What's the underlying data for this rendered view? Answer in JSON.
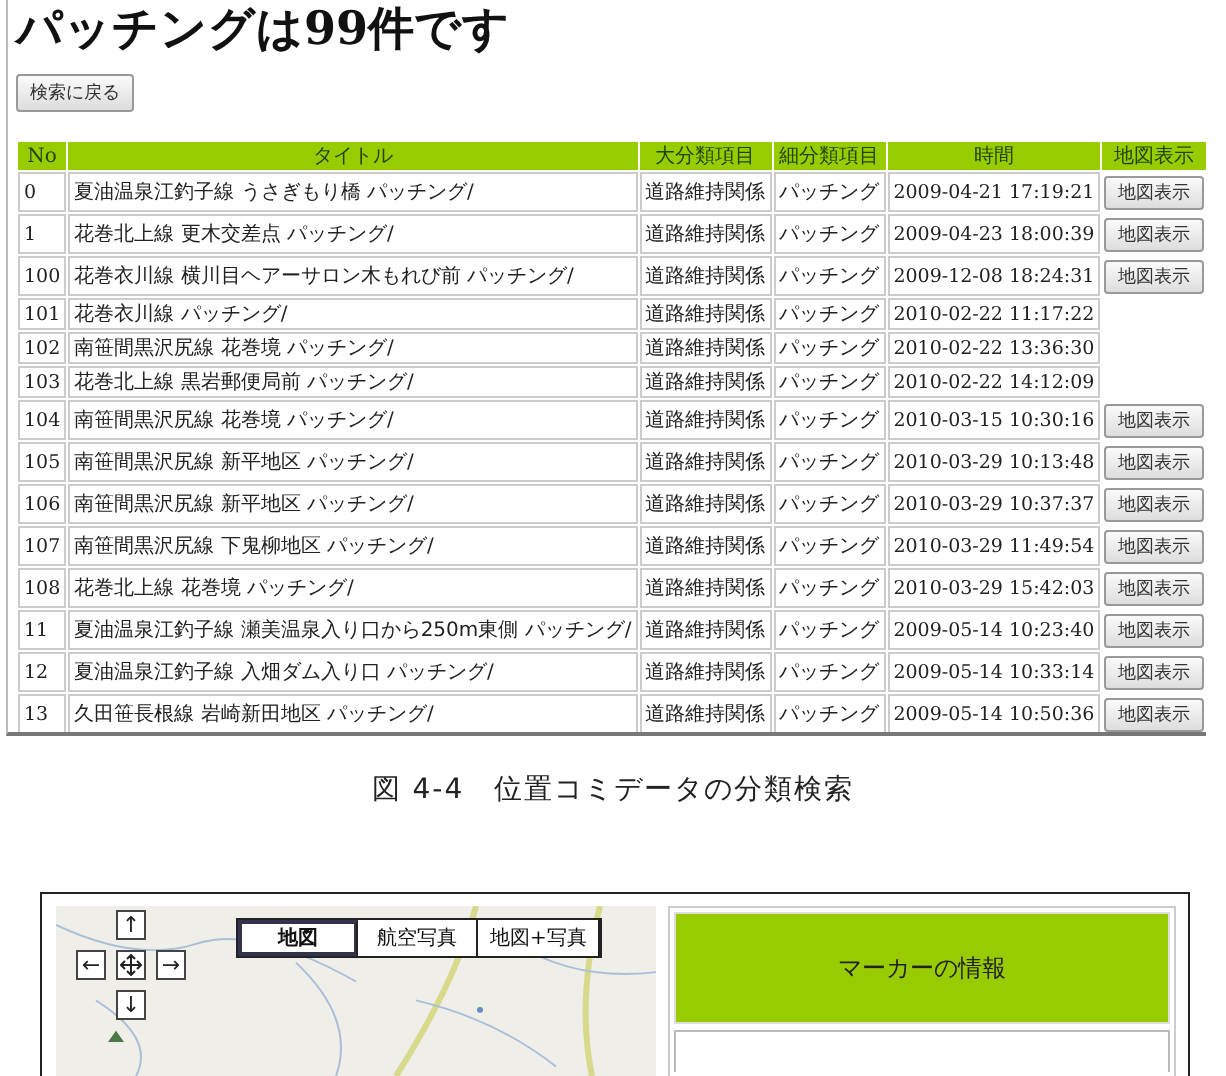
{
  "page_title": "パッチングは99件です",
  "back_button": "検索に戻る",
  "table": {
    "columns": [
      "No",
      "タイトル",
      "大分類項目",
      "細分類項目",
      "時間",
      "地図表示"
    ],
    "rows": [
      {
        "no": "0",
        "title": "夏油温泉江釣子線 うさぎもり橋 パッチング/",
        "category": "道路維持関係",
        "subcategory": "パッチング",
        "time": "2009-04-21 17:19:21",
        "map_button": "地図表示"
      },
      {
        "no": "1",
        "title": "花巻北上線 更木交差点 パッチング/",
        "category": "道路維持関係",
        "subcategory": "パッチング",
        "time": "2009-04-23 18:00:39",
        "map_button": "地図表示"
      },
      {
        "no": "100",
        "title": "花巻衣川線 横川目ヘアーサロン木もれび前 パッチング/",
        "category": "道路維持関係",
        "subcategory": "パッチング",
        "time": "2009-12-08 18:24:31",
        "map_button": "地図表示"
      },
      {
        "no": "101",
        "title": "花巻衣川線 パッチング/",
        "category": "道路維持関係",
        "subcategory": "パッチング",
        "time": "2010-02-22 11:17:22"
      },
      {
        "no": "102",
        "title": "南笹間黒沢尻線 花巻境 パッチング/",
        "category": "道路維持関係",
        "subcategory": "パッチング",
        "time": "2010-02-22 13:36:30"
      },
      {
        "no": "103",
        "title": "花巻北上線 黒岩郵便局前 パッチング/",
        "category": "道路維持関係",
        "subcategory": "パッチング",
        "time": "2010-02-22 14:12:09"
      },
      {
        "no": "104",
        "title": "南笹間黒沢尻線 花巻境 パッチング/",
        "category": "道路維持関係",
        "subcategory": "パッチング",
        "time": "2010-03-15 10:30:16",
        "map_button": "地図表示"
      },
      {
        "no": "105",
        "title": "南笹間黒沢尻線 新平地区 パッチング/",
        "category": "道路維持関係",
        "subcategory": "パッチング",
        "time": "2010-03-29 10:13:48",
        "map_button": "地図表示"
      },
      {
        "no": "106",
        "title": "南笹間黒沢尻線 新平地区 パッチング/",
        "category": "道路維持関係",
        "subcategory": "パッチング",
        "time": "2010-03-29 10:37:37",
        "map_button": "地図表示"
      },
      {
        "no": "107",
        "title": "南笹間黒沢尻線 下鬼柳地区 パッチング/",
        "category": "道路維持関係",
        "subcategory": "パッチング",
        "time": "2010-03-29 11:49:54",
        "map_button": "地図表示"
      },
      {
        "no": "108",
        "title": "花巻北上線 花巻境 パッチング/",
        "category": "道路維持関係",
        "subcategory": "パッチング",
        "time": "2010-03-29 15:42:03",
        "map_button": "地図表示"
      },
      {
        "no": "11",
        "title": "夏油温泉江釣子線 瀬美温泉入り口から250m東側 パッチング/",
        "category": "道路維持関係",
        "subcategory": "パッチング",
        "time": "2009-05-14 10:23:40",
        "map_button": "地図表示"
      },
      {
        "no": "12",
        "title": "夏油温泉江釣子線 入畑ダム入り口 パッチング/",
        "category": "道路維持関係",
        "subcategory": "パッチング",
        "time": "2009-05-14 10:33:14",
        "map_button": "地図表示"
      },
      {
        "no": "13",
        "title": "久田笹長根線 岩崎新田地区 パッチング/",
        "category": "道路維持関係",
        "subcategory": "パッチング",
        "time": "2009-05-14 10:50:36",
        "map_button": "地図表示"
      }
    ]
  },
  "figure_caption": "図 4-4　位置コミデータの分類検索",
  "map_view": {
    "nav_buttons": [
      {
        "kind": "up",
        "label": "↑"
      },
      {
        "kind": "left",
        "label": "←"
      },
      {
        "kind": "center"
      },
      {
        "kind": "right",
        "label": "→"
      },
      {
        "kind": "down",
        "label": "↓"
      }
    ],
    "map_types": [
      {
        "label": "地図",
        "selected": true
      },
      {
        "label": "航空写真",
        "selected": false
      },
      {
        "label": "地図+写真",
        "selected": false
      }
    ],
    "marker_panel_title": "マーカーの情報"
  }
}
